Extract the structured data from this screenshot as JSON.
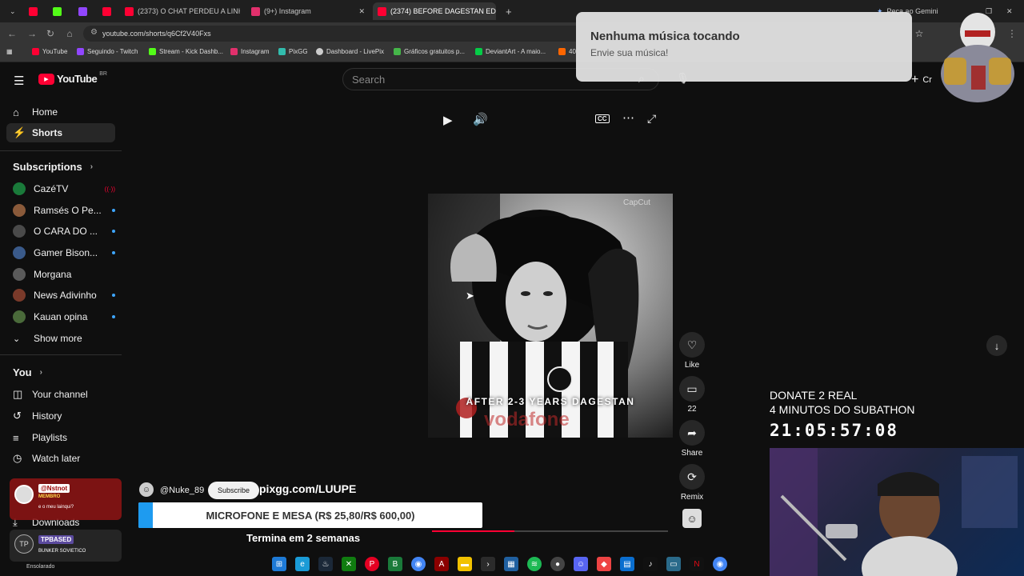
{
  "browser": {
    "tabs": [
      {
        "label": "",
        "color": "#ff0033"
      },
      {
        "label": "",
        "color": "#53fc18"
      },
      {
        "label": "",
        "color": "#9146ff"
      },
      {
        "label": "",
        "color": "#ff0033"
      },
      {
        "label": "(2373) O CHAT PERDEU A LINH",
        "color": "#ff0033"
      },
      {
        "label": "(9+) Instagram",
        "color": "#e1306c"
      },
      {
        "label": "(2374) BEFORE DAGESTAN EDI",
        "color": "#ff0033"
      }
    ],
    "url": "youtube.com/shorts/q6Cf2V40Fxs",
    "gemini": "Peça ao Gemini",
    "bookmarks": [
      {
        "label": "YouTube",
        "color": "#ff0033"
      },
      {
        "label": "Seguindo - Twitch",
        "color": "#9146ff"
      },
      {
        "label": "Stream - Kick Dashb...",
        "color": "#53fc18"
      },
      {
        "label": "Instagram",
        "color": "#e1306c"
      },
      {
        "label": "PixGG",
        "color": "#32bcad"
      },
      {
        "label": "Dashboard - LivePix",
        "color": "#cccccc"
      },
      {
        "label": "Gráficos gratuitos p...",
        "color": "#45b649"
      },
      {
        "label": "DeviantArt - A maio...",
        "color": "#05cc47"
      },
      {
        "label": "40",
        "color": "#ff6600"
      }
    ]
  },
  "youtube": {
    "logo": "YouTube",
    "region": "BR",
    "search_placeholder": "Search",
    "create": "Cr",
    "nav": [
      {
        "label": "Home",
        "icon": "home-icon"
      },
      {
        "label": "Shorts",
        "icon": "shorts-icon"
      }
    ],
    "subscriptions_title": "Subscriptions",
    "subscriptions": [
      {
        "name": "CazéTV",
        "color": "#1a7a3a",
        "live": true
      },
      {
        "name": "Ramsés O Pe...",
        "color": "#8a5a3a",
        "live": false
      },
      {
        "name": "O CARA DO ...",
        "color": "#4a4a4a",
        "live": false
      },
      {
        "name": "Gamer Bison...",
        "color": "#3a5a8a",
        "live": false
      },
      {
        "name": "Morgana",
        "color": "#5a5a5a",
        "live": false
      },
      {
        "name": "News Adivinho",
        "color": "#7a3a2a",
        "live": false
      },
      {
        "name": "Kauan opina",
        "color": "#4a6a3a",
        "live": false
      }
    ],
    "show_more": "Show more",
    "you_title": "You",
    "you_items": [
      {
        "label": "Your channel",
        "icon": "your-channel-icon"
      },
      {
        "label": "History",
        "icon": "history-icon"
      },
      {
        "label": "Playlists",
        "icon": "playlists-icon"
      },
      {
        "label": "Watch later",
        "icon": "watch-later-icon"
      },
      {
        "label": "Downloads",
        "icon": "downloads-icon"
      }
    ],
    "short": {
      "caption": "AFTER 2-3 YEARS DAGESTAN",
      "watermark": "CapCut",
      "channel": "@Nuke_89",
      "subscribe": "Subscribe",
      "progress": 0.35
    },
    "actions": [
      {
        "label": "Like",
        "icon": "like-icon"
      },
      {
        "label": "22",
        "icon": "comment-icon"
      },
      {
        "label": "Share",
        "icon": "share-icon"
      },
      {
        "label": "Remix",
        "icon": "remix-icon"
      }
    ]
  },
  "notification": {
    "title": "Nenhuma música tocando",
    "subtitle": "Envie sua música!"
  },
  "stream_overlay": {
    "pix_url": "pixgg.com/LUUPE",
    "goal": "MICROFONE E MESA (R$ 25,80/R$ 600,00)",
    "goal_progress": 0.043,
    "ends": "Termina em 2 semanas",
    "donate_line1": "DONATE 2 REAL",
    "donate_line2": "4 MINUTOS DO SUBATHON",
    "timer": "21:05:57:08",
    "chat": [
      {
        "user": "@Nstnot",
        "badge": "MEMBRO",
        "message": "e o meu lainqui?"
      },
      {
        "user": "TPBASED",
        "badge": "",
        "message": "BUNKER SOVIETICO"
      }
    ],
    "weather": "Ensolarado"
  },
  "colors": {
    "youtube_red": "#ff0033",
    "background": "#0f0f0f",
    "link_blue": "#3ea6ff"
  }
}
